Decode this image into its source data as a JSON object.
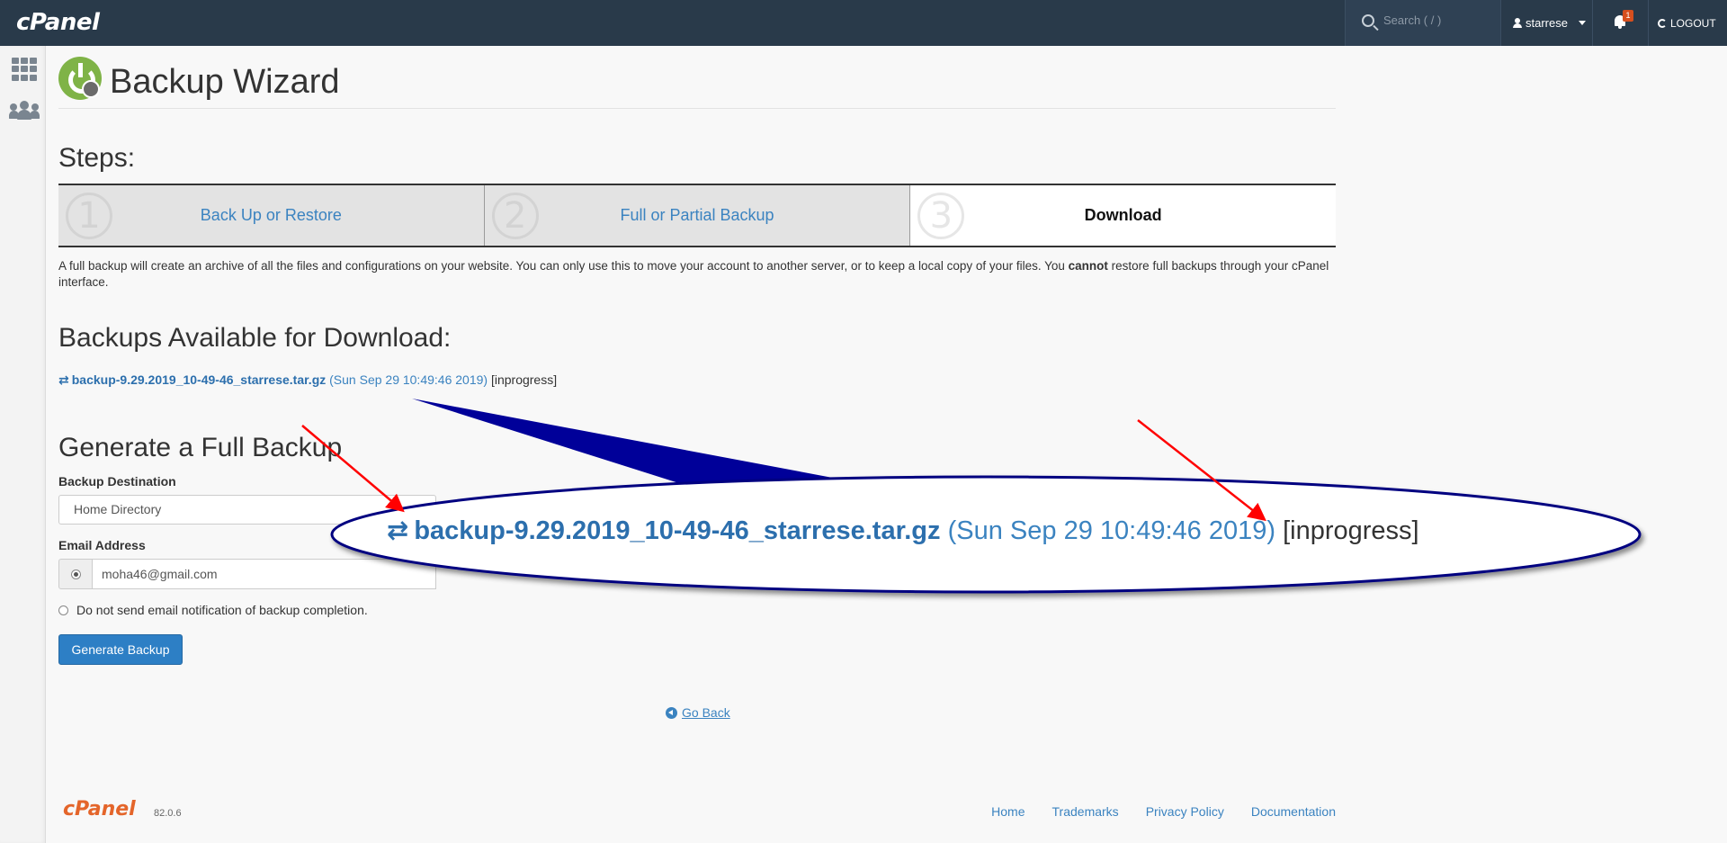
{
  "header": {
    "logo": "cPanel",
    "search_placeholder": "Search ( / )",
    "username": "starrese",
    "notification_count": "1",
    "logout_label": "LOGOUT"
  },
  "page": {
    "title": "Backup Wizard"
  },
  "steps": {
    "heading": "Steps:",
    "items": [
      {
        "number": "1",
        "label": "Back Up or Restore"
      },
      {
        "number": "2",
        "label": "Full or Partial Backup"
      },
      {
        "number": "3",
        "label": "Download"
      }
    ]
  },
  "description": {
    "part1": "A full backup will create an archive of all the files and configurations on your website. You can only use this to move your account to another server, or to keep a local copy of your files. You ",
    "bold": "cannot",
    "part2": " restore full backups through your cPanel interface."
  },
  "backups": {
    "heading": "Backups Available for Download:",
    "items": [
      {
        "filename": "backup-9.29.2019_10-49-46_starrese.tar.gz",
        "date": "(Sun Sep 29 10:49:46 2019)",
        "status": "[inprogress]"
      }
    ]
  },
  "generate": {
    "heading": "Generate a Full Backup",
    "destination_label": "Backup Destination",
    "destination_value": "Home Directory",
    "email_label": "Email Address",
    "email_value": "moha46@gmail.com",
    "no_email_label": "Do not send email notification of backup completion.",
    "button_label": "Generate Backup"
  },
  "go_back_label": "Go Back",
  "footer": {
    "logo": "cPanel",
    "version": "82.0.6",
    "links": [
      "Home",
      "Trademarks",
      "Privacy Policy",
      "Documentation"
    ]
  },
  "colors": {
    "topbar": "#293a4a",
    "link": "#3b83c0",
    "primary_button": "#2d7fc5",
    "annotation_fill": "#000099",
    "annotation_arrow": "#ff0000",
    "footer_logo": "#e4652a"
  }
}
